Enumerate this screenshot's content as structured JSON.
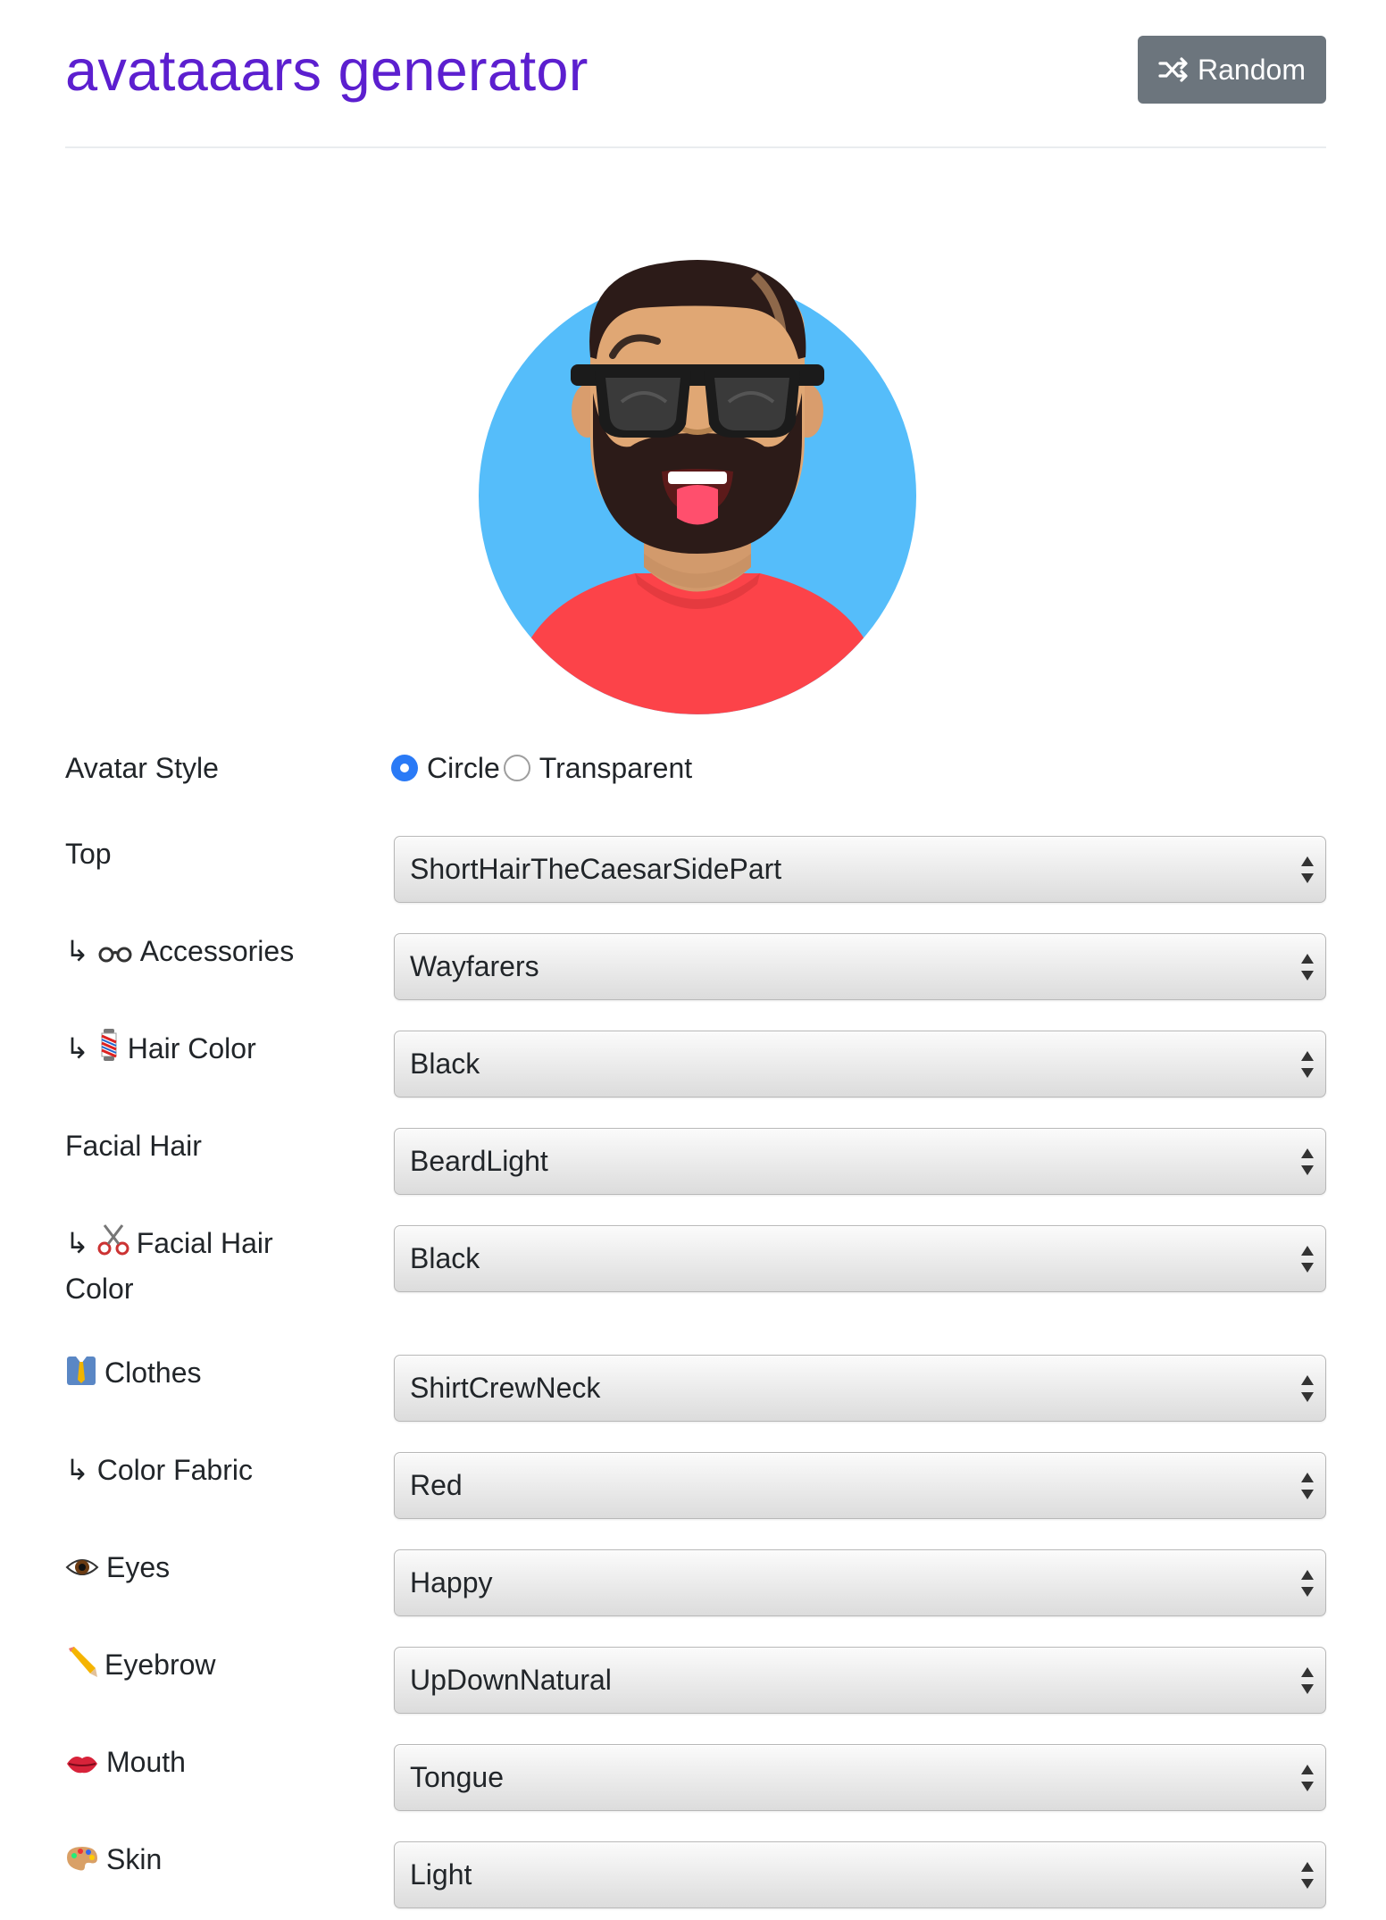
{
  "header": {
    "title": "avataaars generator",
    "random_label": "Random"
  },
  "avatar": {
    "background_color": "#55bdfa",
    "skin_color": "#e0a774",
    "shirt_color": "#fc4349",
    "hair_color": "#2c1b18"
  },
  "form": {
    "avatar_style": {
      "label": "Avatar Style",
      "options": [
        "Circle",
        "Transparent"
      ],
      "selected": "Circle"
    },
    "top": {
      "label": "Top",
      "value": "ShortHairTheCaesarSidePart"
    },
    "accessories": {
      "arrow": "↳",
      "icon": "glasses-icon",
      "label": "Accessories",
      "value": "Wayfarers"
    },
    "hair_color": {
      "arrow": "↳",
      "icon": "barber-pole-icon",
      "label": "Hair Color",
      "value": "Black"
    },
    "facial_hair": {
      "label": "Facial Hair",
      "value": "BeardLight"
    },
    "facial_hair_color": {
      "arrow": "↳",
      "icon": "scissors-icon",
      "label": "Facial Hair Color",
      "value": "Black"
    },
    "clothes": {
      "icon": "necktie-icon",
      "label": "Clothes",
      "value": "ShirtCrewNeck"
    },
    "color_fabric": {
      "arrow": "↳",
      "label": "Color Fabric",
      "value": "Red"
    },
    "eyes": {
      "icon": "eye-icon",
      "label": "Eyes",
      "value": "Happy"
    },
    "eyebrow": {
      "icon": "pencil-icon",
      "label": "Eyebrow",
      "value": "UpDownNatural"
    },
    "mouth": {
      "icon": "lips-icon",
      "label": "Mouth",
      "value": "Tongue"
    },
    "skin": {
      "icon": "palette-icon",
      "label": "Skin",
      "value": "Light"
    }
  }
}
